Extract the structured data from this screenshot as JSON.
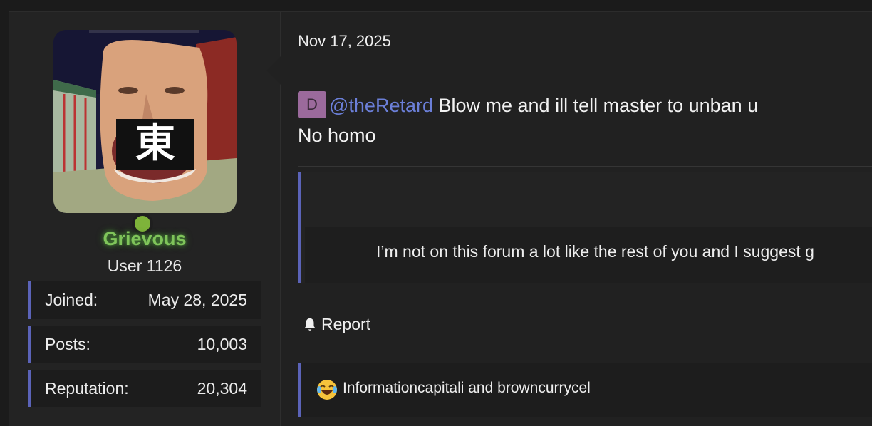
{
  "post": {
    "date": "Nov 17, 2025"
  },
  "user": {
    "name": "Grievous",
    "title": "User 1126",
    "avatar_glyph": "東",
    "online": true,
    "colors": {
      "name": "#7fc45a",
      "online_dot": "#7eb33a"
    },
    "stats": [
      {
        "label": "Joined:",
        "value": "May 28, 2025"
      },
      {
        "label": "Posts:",
        "value": "10,003"
      },
      {
        "label": "Reputation:",
        "value": "20,304"
      }
    ]
  },
  "message": {
    "mention_badge": "D",
    "mention": "@theRetard",
    "line1_rest": " Blow me and ill tell master to unban u",
    "line2": "No homo"
  },
  "quote": {
    "text": "I’m not on this forum a lot like the rest of you and I suggest g"
  },
  "actions": {
    "report_label": "Report",
    "report_icon": "bell-icon"
  },
  "reactions": {
    "emoji": "crying-laughing-emoji",
    "text": "Informationcapitali and browncurrycel"
  },
  "colors": {
    "accent": "#5b63b8",
    "mention": "#6b7fd8",
    "mention_badge_bg": "#9b6a9c",
    "background": "#1b1b1b"
  }
}
